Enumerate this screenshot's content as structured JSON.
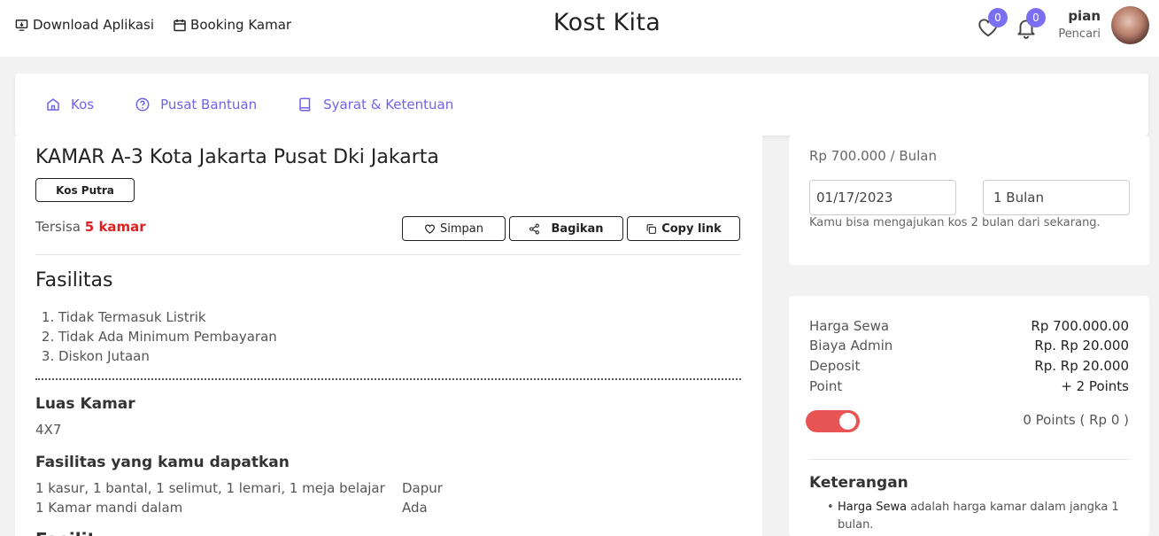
{
  "header": {
    "download_label": "Download Aplikasi",
    "booking_label": "Booking Kamar",
    "brand": "Kost Kita",
    "wishlist_count": "0",
    "notif_count": "0",
    "user_name": "pian",
    "user_role": "Pencari"
  },
  "nav": {
    "items": [
      {
        "label": "Kos",
        "icon": "home-icon"
      },
      {
        "label": "Pusat Bantuan",
        "icon": "help-circle-icon"
      },
      {
        "label": "Syarat & Ketentuan",
        "icon": "book-icon"
      }
    ],
    "accent_color": "#6f63e8"
  },
  "room": {
    "title": "KAMAR A-3 Kota Jakarta Pusat Dki Jakarta",
    "tag": "Kos Putra",
    "remaining_prefix": "Tersisa",
    "remaining_count": "5 kamar",
    "save_label": "Simpan",
    "share_label": "Bagikan",
    "copy_label": "Copy link"
  },
  "fasilitas": {
    "heading": "Fasilitas",
    "items": [
      "Tidak Termasuk Listrik",
      "Tidak Ada Minimum Pembayaran",
      "Diskon Jutaan"
    ]
  },
  "luas": {
    "heading": "Luas Kamar",
    "value": "4X7"
  },
  "fasilitas_didapat": {
    "heading": "Fasilitas yang kamu dapatkan",
    "row1_left": "1 kasur, 1 bantal, 1 selimut, 1 lemari, 1 meja belajar",
    "row1_right": "Dapur",
    "row2_left": "1 Kamar mandi dalam",
    "row2_right": "Ada",
    "next_heading_partial": "Fasilit"
  },
  "booking": {
    "price": "Rp 700.000 / Bulan",
    "date": "01/17/2023",
    "duration": "1 Bulan",
    "hint": "Kamu bisa mengajukan kos 2 bulan dari sekarang."
  },
  "summary": {
    "rows": [
      {
        "label": "Harga Sewa",
        "value": "Rp 700.000.00"
      },
      {
        "label": "Biaya Admin",
        "value": "Rp. Rp 20.000"
      },
      {
        "label": "Deposit",
        "value": "Rp. Rp 20.000"
      },
      {
        "label": "Point",
        "value": "+ 2 Points"
      }
    ],
    "points_text": "0 Points ( Rp 0 )",
    "toggle_on": true,
    "ket_title": "Keterangan",
    "ket_bold": "Harga Sewa",
    "ket_rest": " adalah harga kamar dalam jangka 1 bulan."
  }
}
